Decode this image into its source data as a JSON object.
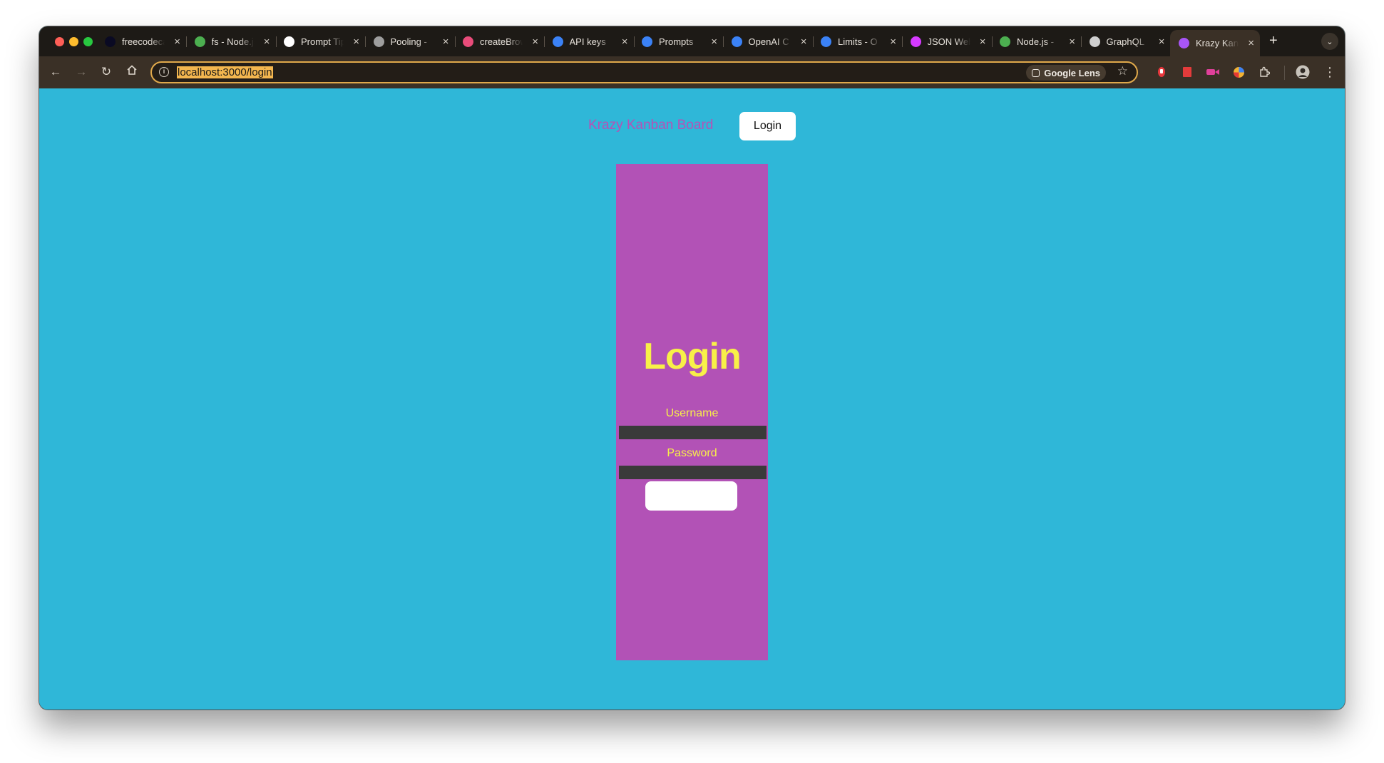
{
  "browser": {
    "tabs": [
      {
        "title": "freecodecamp",
        "icon": "freecodecamp-icon",
        "color": "#0a0a23"
      },
      {
        "title": "fs - Node.js",
        "icon": "nodejs-icon",
        "color": "#4caf50"
      },
      {
        "title": "Prompt Tips",
        "icon": "prompt-icon",
        "color": "#ffffff"
      },
      {
        "title": "Pooling - ",
        "icon": "globe-icon",
        "color": "#9e9e9e"
      },
      {
        "title": "createBrowser",
        "icon": "react-router-icon",
        "color": "#e94c7a"
      },
      {
        "title": "API keys",
        "icon": "openai-icon",
        "color": "#3b82f6"
      },
      {
        "title": "Prompts",
        "icon": "openai-icon",
        "color": "#3b82f6"
      },
      {
        "title": "OpenAI C",
        "icon": "openai-icon",
        "color": "#3b82f6"
      },
      {
        "title": "Limits - O",
        "icon": "openai-icon",
        "color": "#3b82f6"
      },
      {
        "title": "JSON Web",
        "icon": "jwt-icon",
        "color": "#d63aff"
      },
      {
        "title": "Node.js - ",
        "icon": "nodejs-icon",
        "color": "#4caf50"
      },
      {
        "title": "GraphQL",
        "icon": "apollo-icon",
        "color": "#cfcfcf"
      },
      {
        "title": "Krazy Kanban",
        "icon": "vite-icon",
        "color": "#a855f7",
        "active": true
      }
    ],
    "url": "localhost:3000/login",
    "lens_label": "Google Lens",
    "extension_colors": [
      "#e8383d",
      "#e33b3b",
      "#e0409a",
      "#f2b233"
    ]
  },
  "page": {
    "brand": "Krazy Kanban Board",
    "nav_login": "Login",
    "form": {
      "heading": "Login",
      "username_label": "Username",
      "password_label": "Password",
      "username_value": "",
      "password_value": "",
      "submit_label": ""
    },
    "colors": {
      "background": "#2fb7d8",
      "card": "#b252b6",
      "heading": "#f8f048",
      "brand": "#b552b6"
    }
  }
}
